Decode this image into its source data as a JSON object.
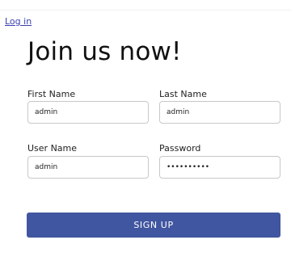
{
  "header": {
    "login_link": "Log in"
  },
  "form": {
    "title": "Join us now!",
    "first_name": {
      "label": "First Name",
      "value": "admin"
    },
    "last_name": {
      "label": "Last Name",
      "value": "admin"
    },
    "user_name": {
      "label": "User Name",
      "value": "admin"
    },
    "password": {
      "label": "Password",
      "value": "**********"
    },
    "submit_label": "SIGN UP"
  },
  "colors": {
    "button": "#4156a0",
    "link": "#3a3fb0"
  }
}
